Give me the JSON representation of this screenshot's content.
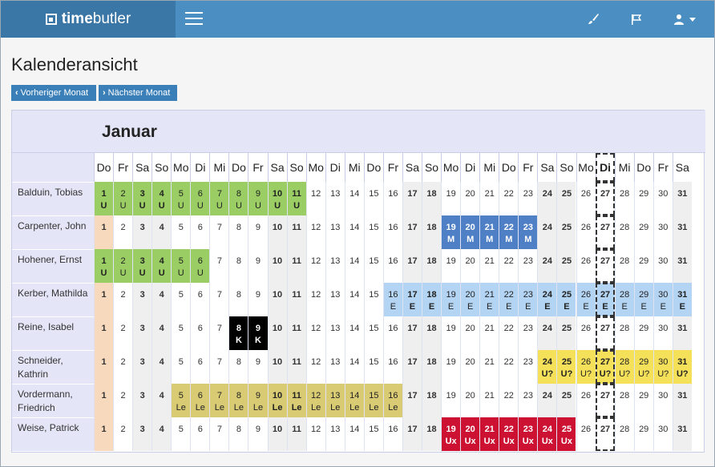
{
  "app": {
    "brand_bold": "time",
    "brand_rest": "butler"
  },
  "icons": {
    "menu": "hamburger-icon",
    "brush": "brush-icon",
    "flag": "flag-icon",
    "user": "user-icon",
    "caret": "caret-down-icon"
  },
  "page": {
    "title": "Kalenderansicht",
    "prev_label": "Vorheriger Monat",
    "next_label": "Nächster Monat"
  },
  "calendar": {
    "month": "Januar",
    "today": 27,
    "weekends": [
      3,
      4,
      10,
      11,
      17,
      18,
      24,
      25,
      31
    ],
    "days": [
      {
        "n": 1,
        "w": "Do"
      },
      {
        "n": 2,
        "w": "Fr"
      },
      {
        "n": 3,
        "w": "Sa"
      },
      {
        "n": 4,
        "w": "So"
      },
      {
        "n": 5,
        "w": "Mo"
      },
      {
        "n": 6,
        "w": "Di"
      },
      {
        "n": 7,
        "w": "Mi"
      },
      {
        "n": 8,
        "w": "Do"
      },
      {
        "n": 9,
        "w": "Fr"
      },
      {
        "n": 10,
        "w": "Sa"
      },
      {
        "n": 11,
        "w": "So"
      },
      {
        "n": 12,
        "w": "Mo"
      },
      {
        "n": 13,
        "w": "Di"
      },
      {
        "n": 14,
        "w": "Mi"
      },
      {
        "n": 15,
        "w": "Do"
      },
      {
        "n": 16,
        "w": "Fr"
      },
      {
        "n": 17,
        "w": "Sa"
      },
      {
        "n": 18,
        "w": "So"
      },
      {
        "n": 19,
        "w": "Mo"
      },
      {
        "n": 20,
        "w": "Di"
      },
      {
        "n": 21,
        "w": "Mi"
      },
      {
        "n": 22,
        "w": "Do"
      },
      {
        "n": 23,
        "w": "Fr"
      },
      {
        "n": 24,
        "w": "Sa"
      },
      {
        "n": 25,
        "w": "So"
      },
      {
        "n": 26,
        "w": "Mo"
      },
      {
        "n": 27,
        "w": "Di"
      },
      {
        "n": 28,
        "w": "Mi"
      },
      {
        "n": 29,
        "w": "Do"
      },
      {
        "n": 30,
        "w": "Fr"
      },
      {
        "n": 31,
        "w": "Sa"
      }
    ],
    "rows": [
      {
        "name": "Balduin, Tobias",
        "spans": [
          {
            "from": 1,
            "to": 11,
            "code": "U"
          }
        ]
      },
      {
        "name": "Carpenter, John",
        "spans": [
          {
            "from": 19,
            "to": 23,
            "code": "M"
          }
        ]
      },
      {
        "name": "Hohener, Ernst",
        "spans": [
          {
            "from": 1,
            "to": 6,
            "code": "U"
          }
        ]
      },
      {
        "name": "Kerber, Mathilda",
        "spans": [
          {
            "from": 16,
            "to": 31,
            "code": "E"
          }
        ]
      },
      {
        "name": "Reine, Isabel",
        "spans": [
          {
            "from": 8,
            "to": 9,
            "code": "K"
          }
        ]
      },
      {
        "name": "Schneider, Kathrin",
        "spans": [
          {
            "from": 24,
            "to": 31,
            "code": "U?"
          }
        ]
      },
      {
        "name": "Vordermann, Friedrich",
        "spans": [
          {
            "from": 5,
            "to": 16,
            "code": "Le"
          }
        ]
      },
      {
        "name": "Weise, Patrick",
        "spans": [
          {
            "from": 19,
            "to": 25,
            "code": "Ux"
          }
        ]
      }
    ]
  }
}
